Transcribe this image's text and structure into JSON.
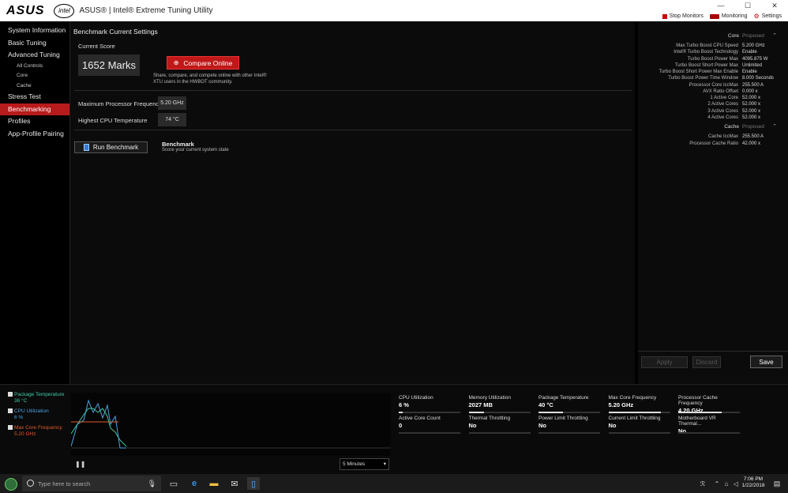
{
  "titlebar": {
    "brand": "ASUS",
    "intel": "intel",
    "title": "ASUS® | Intel® Extreme Tuning Utility",
    "minimize": "—",
    "maximize": "☐",
    "close": "✕",
    "stop_monitors": "Stop Monitors",
    "monitoring": "Monitoring",
    "settings": "Settings"
  },
  "sidebar": {
    "items": [
      {
        "label": "System Information"
      },
      {
        "label": "Basic Tuning"
      },
      {
        "label": "Advanced Tuning"
      },
      {
        "label": "All Controls"
      },
      {
        "label": "Core"
      },
      {
        "label": "Cache"
      },
      {
        "label": "Stress Test"
      },
      {
        "label": "Benchmarking"
      },
      {
        "label": "Profiles"
      },
      {
        "label": "App-Profile Pairing"
      }
    ]
  },
  "main": {
    "title": "Benchmark Current Settings",
    "current_score_label": "Current Score",
    "score": "1652 Marks",
    "compare_button": "Compare Online",
    "compare_desc": "Share, compare, and compete online with other Intel® XTU users in the HWBOT community.",
    "max_freq_label": "Maximum Processor Frequency",
    "max_freq_value": "5.20 GHz",
    "max_temp_label": "Highest CPU Temperature",
    "max_temp_value": "74 °C",
    "run_button": "Run Benchmark",
    "bench_title": "Benchmark",
    "bench_desc": "Score your current system state"
  },
  "right_panel": {
    "core_header": "Core",
    "proposed": "Proposed",
    "core_rows": [
      {
        "k": "Max Turbo Boost CPU Speed",
        "v": "5.200 GHz"
      },
      {
        "k": "Intel® Turbo Boost Technology",
        "v": "Enable"
      },
      {
        "k": "Turbo Boost Power Max",
        "v": "4095.875 W"
      },
      {
        "k": "Turbo Boost Short Power Max",
        "v": "Unlimited"
      },
      {
        "k": "Turbo Boost Short Power Max Enable",
        "v": "Enable"
      },
      {
        "k": "Turbo Boost Power Time Window",
        "v": "8.000 Seconds"
      },
      {
        "k": "Processor Core IccMax",
        "v": "255.500 A"
      },
      {
        "k": "AVX Ratio Offset",
        "v": "0.000 x"
      },
      {
        "k": "1 Active Core",
        "v": "52.000 x"
      },
      {
        "k": "2 Active Cores",
        "v": "52.000 x"
      },
      {
        "k": "3 Active Cores",
        "v": "52.000 x"
      },
      {
        "k": "4 Active Cores",
        "v": "52.000 x"
      }
    ],
    "cache_header": "Cache",
    "cache_rows": [
      {
        "k": "Cache IccMax",
        "v": "255.500 A"
      },
      {
        "k": "Processor Cache Ratio",
        "v": "42.000 x"
      }
    ],
    "apply": "Apply",
    "discard": "Discard",
    "save": "Save"
  },
  "monitor": {
    "legend": [
      {
        "name": "Package Temperature",
        "value": "36 °C",
        "color": "#3ec9a7"
      },
      {
        "name": "CPU Utilization",
        "value": "6 %",
        "color": "#4aa3df"
      },
      {
        "name": "Max Core Frequency",
        "value": "5.20 GHz",
        "color": "#e05a2a"
      }
    ],
    "pause": "❚❚",
    "time_range": "5 Minutes",
    "metrics": [
      {
        "k": "CPU Utilization",
        "v": "6 %",
        "fill": 0.06
      },
      {
        "k": "Memory Utilization",
        "v": "2027  MB",
        "fill": 0.25
      },
      {
        "k": "Package Temperature",
        "v": "40 °C",
        "fill": 0.4
      },
      {
        "k": "Max Core Frequency",
        "v": "5.20 GHz",
        "fill": 0.85
      },
      {
        "k": "Processor Cache Frequency",
        "v": "4.20 GHz",
        "fill": 0.7
      },
      {
        "k": "Active Core Count",
        "v": "0",
        "fill": 0
      },
      {
        "k": "Thermal Throttling",
        "v": "No",
        "fill": 0
      },
      {
        "k": "Power Limit Throttling",
        "v": "No",
        "fill": 0
      },
      {
        "k": "Current Limit Throttling",
        "v": "No",
        "fill": 0
      },
      {
        "k": "Motherboard VR Thermal...",
        "v": "No",
        "fill": 0
      }
    ]
  },
  "taskbar": {
    "search_placeholder": "Type here to search",
    "time": "7:06 PM",
    "date": "1/22/2018"
  }
}
